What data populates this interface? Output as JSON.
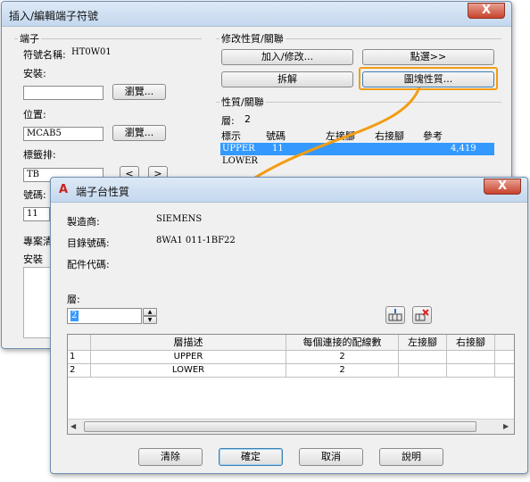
{
  "back_dialog": {
    "title": "插入/編輯端子符號",
    "close_label": "X",
    "terminal_group": "端子",
    "symbol_name_label": "符號名稱:",
    "symbol_name_value": "HT0W01",
    "install_label": "安裝:",
    "install_value": "",
    "browse1": "瀏覽...",
    "location_label": "位置:",
    "location_value": "MCAB5",
    "browse2": "瀏覽...",
    "tag_strip_label": "標籤排:",
    "tag_strip_value": "TB",
    "prev_label": "<",
    "next_label": ">",
    "number_label": "號碼:",
    "number_value": "11",
    "project_label": "專案清",
    "install2_label": "安裝",
    "modify_group": "修改性質/關聯",
    "add_modify_btn": "加入/修改...",
    "pick_btn": "點選>>",
    "unlink_btn": "拆解",
    "block_prop_btn": "圖塊性質...",
    "props_group": "性質/關聯",
    "layer_label": "層:",
    "layer_value": "2",
    "columns": [
      "標示",
      "號碼",
      "左接腳",
      "右接腳",
      "參考"
    ],
    "rows": [
      {
        "tag": "UPPER",
        "num": "11",
        "left": "",
        "right": "",
        "ref": "4,419"
      },
      {
        "tag": "LOWER",
        "num": "",
        "left": "",
        "right": "",
        "ref": ""
      }
    ]
  },
  "front_dialog": {
    "title": "端子台性質",
    "close_label": "X",
    "manufacturer_label": "製造商:",
    "manufacturer_value": "SIEMENS",
    "catalog_label": "目錄號碼:",
    "catalog_value": "8WA1 011-1BF22",
    "assembly_label": "配件代碼:",
    "layer_label": "層:",
    "layer_value": "2",
    "table": {
      "headers": [
        "",
        "層描述",
        "每個連接的配線數",
        "左接腳",
        "右接腳",
        ""
      ],
      "rows": [
        {
          "idx": "1",
          "desc": "UPPER",
          "wires": "2"
        },
        {
          "idx": "2",
          "desc": "LOWER",
          "wires": "2"
        }
      ]
    },
    "clear_btn": "清除",
    "ok_btn": "確定",
    "cancel_btn": "取消",
    "help_btn": "說明"
  },
  "colors": {
    "highlight": "#f39c12",
    "selection": "#3399ff"
  }
}
